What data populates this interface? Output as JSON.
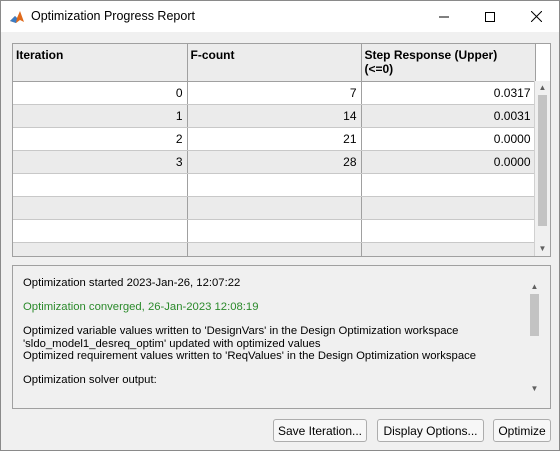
{
  "window": {
    "title": "Optimization Progress Report"
  },
  "table": {
    "headers": [
      "Iteration",
      "F-count",
      "Step Response (Upper)\n(<=0)"
    ],
    "header_line1": "Step Response (Upper)",
    "header_line2": "(<=0)",
    "rows": [
      [
        "0",
        "7",
        "0.0317"
      ],
      [
        "1",
        "14",
        "0.0031"
      ],
      [
        "2",
        "21",
        "0.0000"
      ],
      [
        "3",
        "28",
        "0.0000"
      ]
    ]
  },
  "log": {
    "line1": "Optimization started 2023-Jan-26, 12:07:22",
    "line2": "Optimization converged, 26-Jan-2023 12:08:19",
    "line3": "Optimized variable values written to 'DesignVars' in the Design Optimization workspace",
    "line4": "'sldo_model1_desreq_optim' updated with optimized values",
    "line5": "Optimized requirement values written to 'ReqValues' in the Design Optimization workspace",
    "line6": "Optimization solver output:"
  },
  "buttons": {
    "save_iteration": "Save Iteration...",
    "display_options": "Display Options...",
    "optimize": "Optimize"
  },
  "colors": {
    "converged_text": "#2b8a2b",
    "row_alt": "#ebebeb"
  }
}
